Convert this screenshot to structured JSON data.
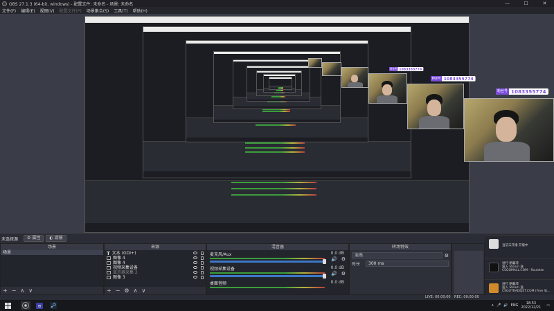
{
  "window": {
    "title": "OBS 27.1.3 (64-bit, windows) - 配置文件: 未命名 - 场景: 未命名",
    "controls": [
      "—",
      "☐",
      "✕"
    ]
  },
  "menu": [
    "文件(F)",
    "编辑(E)",
    "视图(V)",
    "配置文件(P)",
    "场景集合(S)",
    "工具(T)",
    "帮助(H)"
  ],
  "badge": {
    "chip": "粉丝号",
    "number": "1083355774"
  },
  "scene_controls": {
    "label": "未选择源",
    "properties_label": "属性",
    "filters_label": "滤镜"
  },
  "scenes": {
    "header": "场景",
    "items": [
      "场景"
    ],
    "footer_icons": [
      "+",
      "−",
      "∧",
      "∨"
    ]
  },
  "sources": {
    "header": "来源",
    "items": [
      {
        "name": "文本 (GDI+)",
        "icon": "text-icon"
      },
      {
        "name": "图像 4",
        "icon": "image-icon"
      },
      {
        "name": "图像 4",
        "icon": "image-icon"
      },
      {
        "name": "视频采集设备",
        "icon": "camera-icon"
      },
      {
        "name": "显示器采集 2",
        "icon": "monitor-icon"
      },
      {
        "name": "图像 3",
        "icon": "image-icon"
      }
    ],
    "footer_icons": [
      "+",
      "−",
      "⚙",
      "∧",
      "∨"
    ]
  },
  "mixer": {
    "header": "混音器",
    "tracks": [
      {
        "name": "麦克风/Aux",
        "db": "0.0 dB"
      },
      {
        "name": "视频采集设备",
        "db": "0.0 dB"
      },
      {
        "name": "桌面音频",
        "db": "0.0 dB"
      }
    ]
  },
  "transitions": {
    "header": "转场特效",
    "type": "淡出",
    "duration_label": "时长",
    "duration": "300 ms"
  },
  "notifications": [
    {
      "line1": "当前未开播 开播中",
      "line2": ""
    },
    {
      "line1": "进行 朝暮凛",
      "line2": "送入 Steam 送",
      "line3": "CSGOMALL.COM - Roulette"
    },
    {
      "line1": "进行 朝暮凛",
      "line2": "送入 Steam 送",
      "line3": "CSGOTRADEJET.COM (Free St..."
    }
  ],
  "status": {
    "live": "LIVE: 00:00:00",
    "rec": "REC: 00:00:00",
    "cpu": "CPU: 4.1%, 30.00 fps"
  },
  "taskbar": {
    "lang": "ENG",
    "time": "18:53",
    "date": "2022/12/21"
  }
}
